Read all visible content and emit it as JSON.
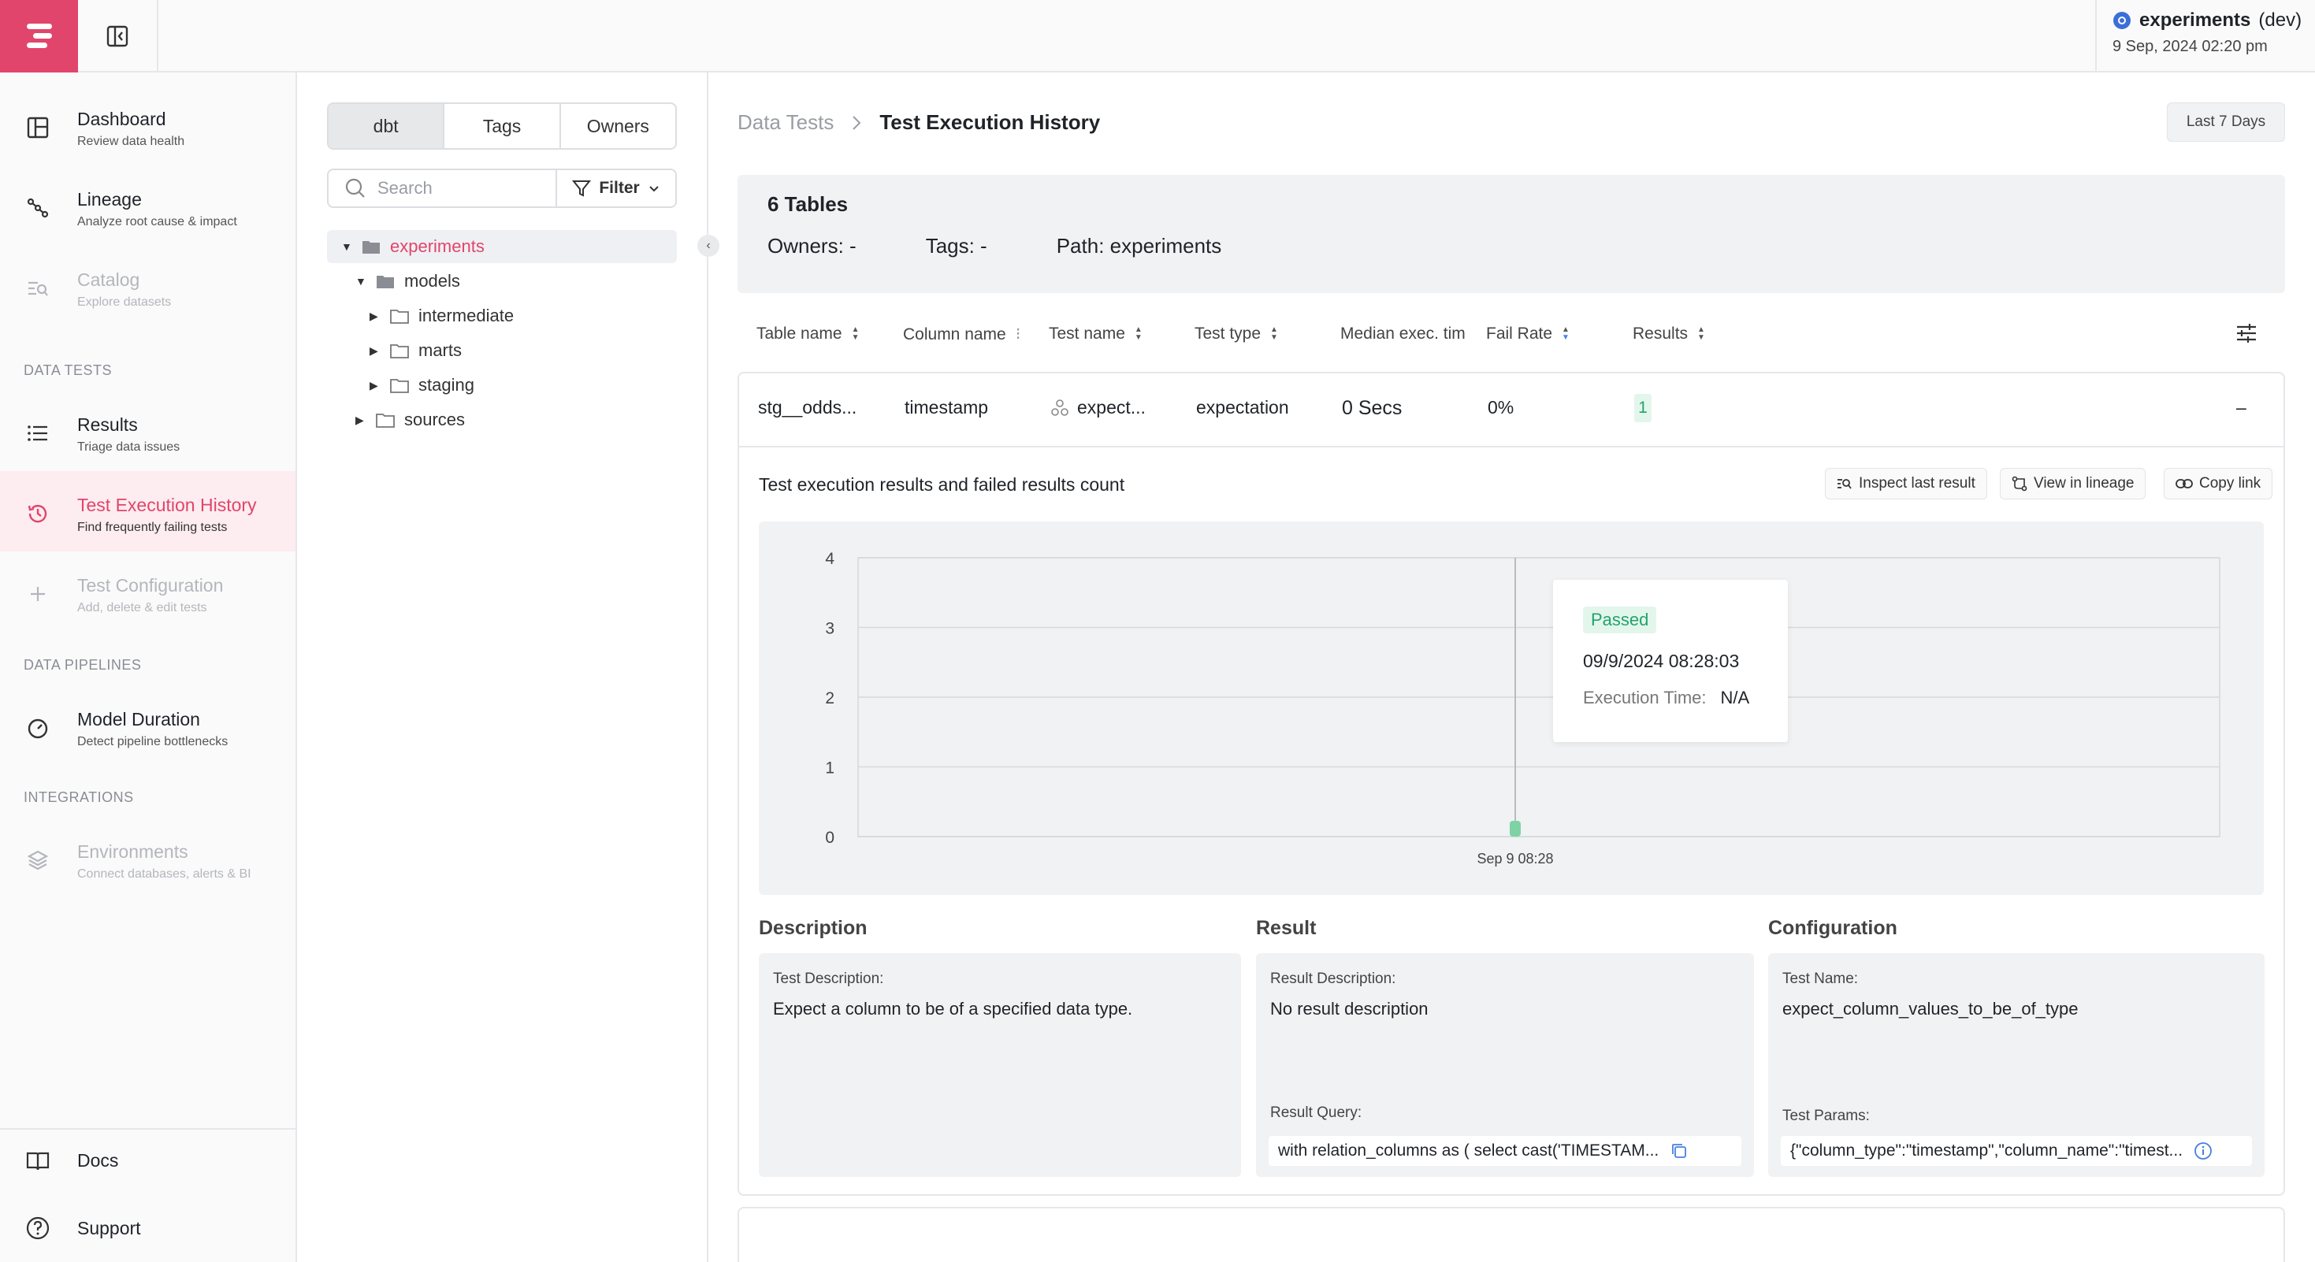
{
  "topbar": {
    "env_name": "experiments",
    "env_suffix": "(dev)",
    "env_date": "9 Sep, 2024 02:20 pm"
  },
  "sidebar": {
    "items": [
      {
        "title": "Dashboard",
        "sub": "Review data health",
        "icon": "dashboard-icon"
      },
      {
        "title": "Lineage",
        "sub": "Analyze root cause & impact",
        "icon": "lineage-icon"
      },
      {
        "title": "Catalog",
        "sub": "Explore datasets",
        "icon": "catalog-icon"
      },
      {
        "title": "Results",
        "sub": "Triage data issues",
        "icon": "list-icon"
      },
      {
        "title": "Test Execution History",
        "sub": "Find frequently failing tests",
        "icon": "history-icon"
      },
      {
        "title": "Test Configuration",
        "sub": "Add, delete & edit tests",
        "icon": "plus-icon"
      },
      {
        "title": "Model Duration",
        "sub": "Detect pipeline bottlenecks",
        "icon": "gauge-icon"
      },
      {
        "title": "Environments",
        "sub": "Connect databases, alerts & BI",
        "icon": "layers-icon"
      }
    ],
    "sections": [
      "DATA TESTS",
      "DATA PIPELINES",
      "INTEGRATIONS"
    ],
    "bottom": [
      "Docs",
      "Support"
    ]
  },
  "tree": {
    "tabs": [
      "dbt",
      "Tags",
      "Owners"
    ],
    "search_placeholder": "Search",
    "filter_label": "Filter",
    "nodes": [
      "experiments",
      "models",
      "intermediate",
      "marts",
      "staging",
      "sources"
    ]
  },
  "main": {
    "breadcrumb": [
      "Data Tests",
      "Test Execution History"
    ],
    "range": "Last 7 Days",
    "summary": {
      "count": "6 Tables",
      "owners": "Owners: -",
      "tags": "Tags: -",
      "path": "Path: experiments"
    },
    "columns": [
      "Table name",
      "Column name",
      "Test name",
      "Test type",
      "Median exec. tim",
      "Fail Rate",
      "Results"
    ],
    "row": {
      "table": "stg__odds...",
      "column": "timestamp",
      "test": "expect...",
      "type": "expectation",
      "exec": "0 Secs",
      "fail": "0%",
      "results": "1",
      "collapse": "–"
    },
    "detail": {
      "title": "Test execution results and failed results count",
      "actions": [
        "Inspect last result",
        "View in lineage",
        "Copy link"
      ],
      "tooltip": {
        "status": "Passed",
        "date": "09/9/2024 08:28:03",
        "exec_label": "Execution Time:",
        "exec_value": "N/A"
      },
      "description": {
        "heading": "Description",
        "label": "Test Description:",
        "value": "Expect a column to be of a specified data type."
      },
      "result": {
        "heading": "Result",
        "label": "Result Description:",
        "value": "No result description",
        "query_label": "Result Query:",
        "query": "with relation_columns as ( select cast('TIMESTAM..."
      },
      "configuration": {
        "heading": "Configuration",
        "label": "Test Name:",
        "value": "expect_column_values_to_be_of_type",
        "params_label": "Test Params:",
        "params": "{\"column_type\":\"timestamp\",\"column_name\":\"timest..."
      }
    }
  },
  "chart_data": {
    "type": "bar",
    "categories": [
      "Sep 9 08:28"
    ],
    "values": [
      0
    ],
    "ylim": [
      0,
      4
    ],
    "yticks": [
      "0",
      "1",
      "2",
      "3",
      "4"
    ],
    "grid": true,
    "colors": {
      "bar": "#7ed3a4",
      "accent": "#e1456b"
    }
  }
}
